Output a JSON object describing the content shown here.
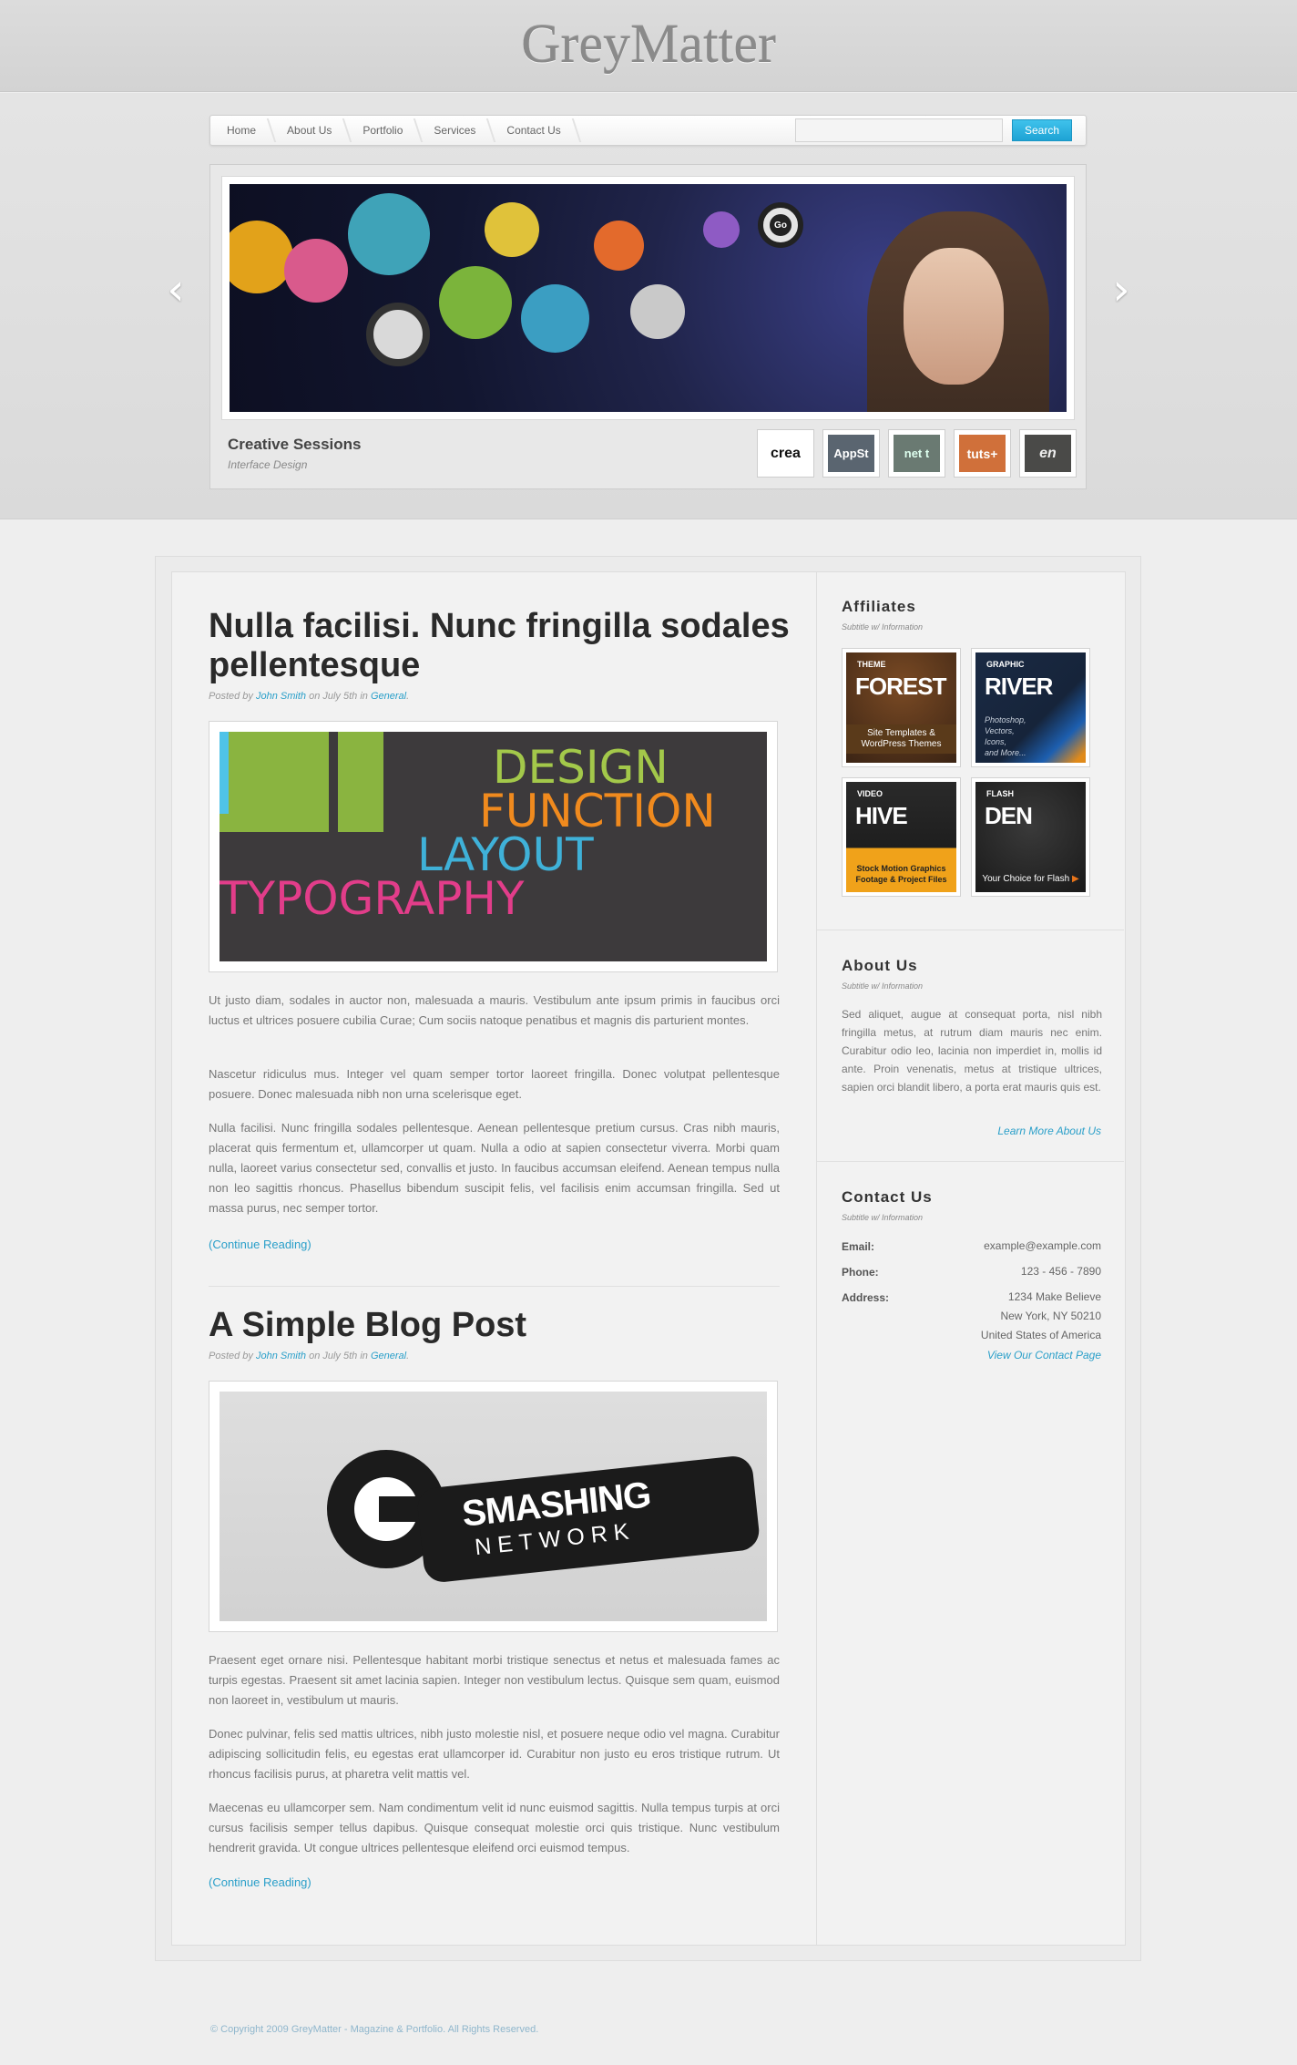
{
  "site": {
    "logo": "GreyMatter"
  },
  "nav": {
    "items": [
      "Home",
      "About Us",
      "Portfolio",
      "Services",
      "Contact Us"
    ],
    "search_placeholder": "",
    "search_button": "Search"
  },
  "slider": {
    "badge": "Go",
    "caption_title": "Creative Sessions",
    "caption_sub": "Interface Design",
    "prev_icon": "‹",
    "next_icon": "›",
    "thumbs": [
      "crea",
      "AppSt",
      "net t",
      "tuts+",
      "en"
    ]
  },
  "posts": [
    {
      "title": "Nulla facilisi. Nunc fringilla sodales pellentesque",
      "meta": {
        "posted_by": "Posted by",
        "author": "John Smith",
        "on": "on July 5th in",
        "category": "General",
        "end": "."
      },
      "image_words": [
        "DESIGN",
        "FUNCTION",
        "LAYOUT",
        "TYPOGRAPHY"
      ],
      "paragraphs": [
        "Ut justo diam, sodales in auctor non, malesuada a mauris. Vestibulum ante ipsum primis in faucibus orci luctus et ultrices posuere cubilia Curae; Cum sociis natoque penatibus et magnis dis parturient montes.",
        "Nascetur ridiculus mus. Integer vel quam semper tortor laoreet fringilla. Donec volutpat pellentesque posuere. Donec malesuada nibh non urna scelerisque eget.",
        "Nulla facilisi. Nunc fringilla sodales pellentesque. Aenean pellentesque pretium cursus. Cras nibh mauris, placerat quis fermentum et, ullamcorper ut quam. Nulla a odio at sapien consectetur viverra. Morbi quam nulla, laoreet varius consectetur sed, convallis et justo. In faucibus accumsan eleifend. Aenean tempus nulla non leo sagittis rhoncus. Phasellus bibendum suscipit felis, vel facilisis enim accumsan fringilla. Sed ut massa purus, nec semper tortor."
      ],
      "continue": "(Continue Reading)"
    },
    {
      "title": "A Simple Blog Post",
      "meta": {
        "posted_by": "Posted by",
        "author": "John Smith",
        "on": "on July 5th in",
        "category": "General",
        "end": "."
      },
      "image_words": [
        "SMASHING",
        "NETWORK"
      ],
      "paragraphs": [
        "Praesent eget ornare nisi. Pellentesque habitant morbi tristique senectus et netus et malesuada fames ac turpis egestas. Praesent sit amet lacinia sapien. Integer non vestibulum lectus. Quisque sem quam, euismod non laoreet in, vestibulum ut mauris.",
        "Donec pulvinar, felis sed mattis ultrices, nibh justo molestie nisl, et posuere neque odio vel magna. Curabitur adipiscing sollicitudin felis, eu egestas erat ullamcorper id. Curabitur non justo eu eros tristique rutrum. Ut rhoncus facilisis purus, at pharetra velit mattis vel.",
        "Maecenas eu ullamcorper sem. Nam condimentum velit id nunc euismod sagittis. Nulla tempus turpis at orci cursus facilisis semper tellus dapibus. Quisque consequat molestie orci quis tristique. Nunc vestibulum hendrerit gravida. Ut congue ultrices pellentesque eleifend orci euismod tempus."
      ],
      "continue": "(Continue Reading)"
    }
  ],
  "sidebar": {
    "affiliates": {
      "title": "Affiliates",
      "sub": "Subtitle w/ Information",
      "items": [
        {
          "small": "THEME",
          "logo": "FOREST",
          "caption1": "Site Templates &",
          "caption2": "WordPress Themes"
        },
        {
          "small": "GRAPHIC",
          "logo": "RIVER",
          "caption1": "Photoshop,",
          "caption2": "Vectors,"
        },
        {
          "small": "VIDEO",
          "logo": "HIVE",
          "caption1": "Stock Motion Graphics",
          "caption2": "Footage & Project Files"
        },
        {
          "small": "FLASH",
          "logo": "DEN",
          "caption1": "Your Choice for Flash",
          "caption2": ""
        }
      ],
      "river_extra": [
        "Icons,",
        "and More..."
      ]
    },
    "about": {
      "title": "About Us",
      "sub": "Subtitle w/ Information",
      "text": "Sed aliquet, augue at consequat porta, nisl nibh fringilla metus, at rutrum diam mauris nec enim. Curabitur odio leo, lacinia non imperdiet in, mollis id ante. Proin venenatis, metus at tristique ultrices, sapien orci blandit libero, a porta erat mauris quis est.",
      "link": "Learn More About Us"
    },
    "contact": {
      "title": "Contact Us",
      "sub": "Subtitle w/ Information",
      "email_label": "Email:",
      "email": "example@example.com",
      "phone_label": "Phone:",
      "phone": "123 - 456 - 7890",
      "address_label": "Address:",
      "address1": "1234 Make Believe",
      "address2": "New York, NY 50210",
      "address3": "United States of America",
      "link": "View Our Contact Page"
    }
  },
  "footer": {
    "text": "© Copyright 2009 GreyMatter - Magazine & Portfolio. All Rights Reserved."
  },
  "colors": {
    "accent": "#2a9fc9",
    "button": "#1ea3d4"
  }
}
